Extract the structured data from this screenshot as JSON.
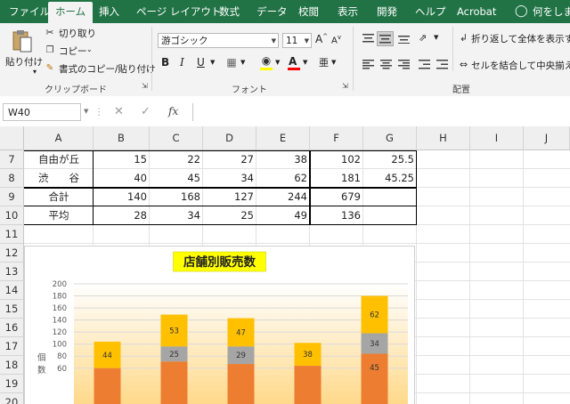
{
  "menu": {
    "tabs": [
      "ファイル",
      "ホーム",
      "挿入",
      "ページ レイアウト",
      "数式",
      "データ",
      "校閲",
      "表示",
      "開発",
      "ヘルプ",
      "Acrobat"
    ],
    "active_tab": "ホーム",
    "search_text": "何をします"
  },
  "ribbon": {
    "clipboard": {
      "paste": "貼り付け",
      "cut": "切り取り",
      "copy": "コピー",
      "format_painter": "書式のコピー/貼り付け",
      "label": "クリップボード"
    },
    "font": {
      "name": "游ゴシック",
      "size": "11",
      "bold": "B",
      "italic": "I",
      "underline": "U",
      "label": "フォント",
      "font_color": "#ff0000",
      "fill_color": "#ffff00"
    },
    "alignment": {
      "wrap": "折り返して全体を表示する",
      "merge": "セルを結合して中央揃え",
      "label": "配置"
    }
  },
  "formula_bar": {
    "name_box": "W40",
    "fx": "fx",
    "value": ""
  },
  "grid": {
    "columns": [
      "A",
      "B",
      "C",
      "D",
      "E",
      "F",
      "G",
      "H",
      "I",
      "J"
    ],
    "rows": [
      "7",
      "8",
      "9",
      "10",
      "11",
      "12",
      "13",
      "14",
      "15",
      "16",
      "17",
      "18",
      "19",
      "20"
    ],
    "table": [
      [
        "自由が丘",
        "15",
        "22",
        "27",
        "38",
        "102",
        "25.5"
      ],
      [
        "渋　　谷",
        "40",
        "45",
        "34",
        "62",
        "181",
        "45.25"
      ],
      [
        "合計",
        "140",
        "168",
        "127",
        "244",
        "679",
        ""
      ],
      [
        "平均",
        "28",
        "34",
        "25",
        "49",
        "136",
        ""
      ]
    ]
  },
  "chart_data": {
    "type": "bar",
    "stacked": true,
    "title": "店舗別販売数",
    "ylabel": "個数",
    "ylim": [
      0,
      200
    ],
    "yticks": [
      60,
      80,
      100,
      120,
      140,
      160,
      180,
      200
    ],
    "visible_labels": [
      [
        "44"
      ],
      [
        "53",
        "25"
      ],
      [
        "47",
        "29"
      ],
      [
        "38"
      ],
      [
        "62",
        "34",
        "45"
      ]
    ],
    "series": [
      {
        "values": [
          null,
          null,
          null,
          null,
          45
        ],
        "color": "#ed7d31"
      },
      {
        "values": [
          null,
          25,
          29,
          null,
          34
        ],
        "color": "#a5a5a5"
      },
      {
        "values": [
          44,
          53,
          47,
          38,
          62
        ],
        "color": "#ffc000"
      }
    ],
    "stack_totals": [
      104,
      149,
      143,
      102,
      180
    ],
    "grid": true,
    "title_bg": "#ffff00"
  }
}
